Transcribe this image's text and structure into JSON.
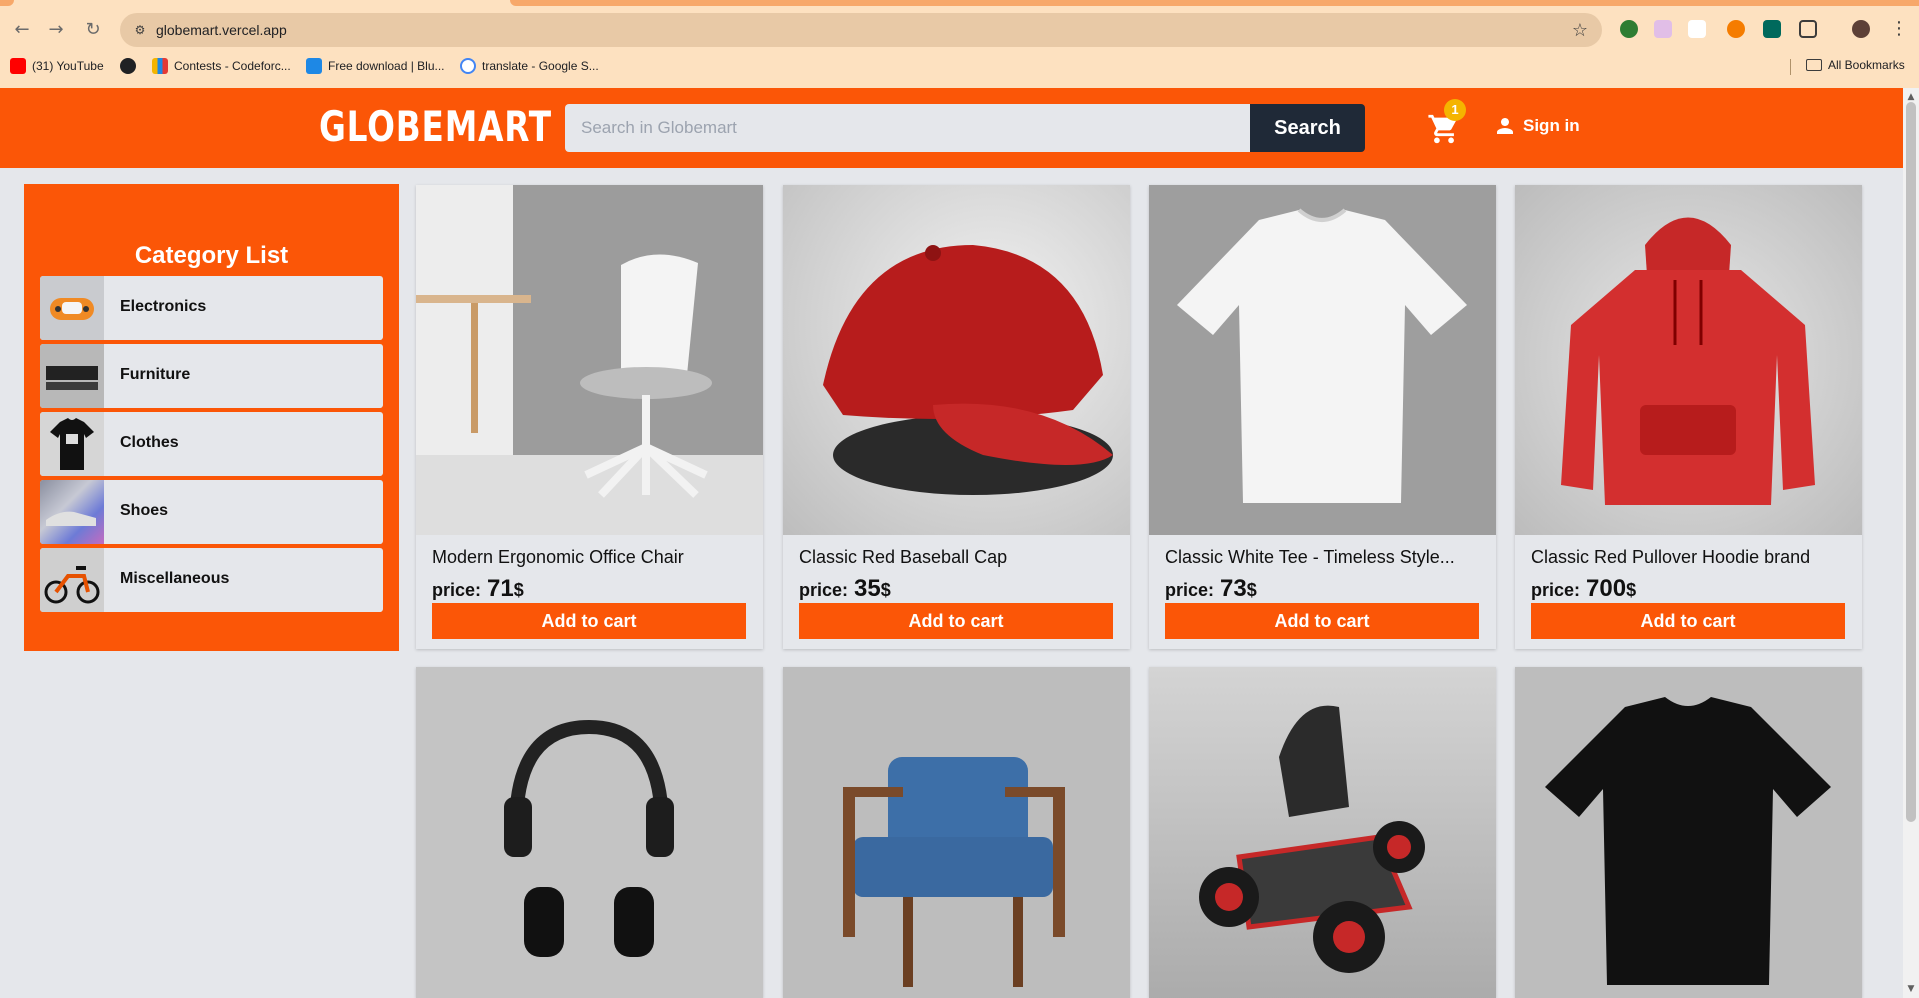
{
  "browser": {
    "url": "globemart.vercel.app",
    "bookmarks": [
      {
        "label": "(31) YouTube",
        "icon": "youtube-icon",
        "color": "#ff0000"
      },
      {
        "label": "",
        "icon": "globe-icon",
        "color": "#202124"
      },
      {
        "label": "Contests - Codeforc...",
        "icon": "codeforces-icon",
        "color": "#3b5998"
      },
      {
        "label": "Free download | Blu...",
        "icon": "bluestacks-icon",
        "color": "#1e88e5"
      },
      {
        "label": "translate - Google S...",
        "icon": "google-icon",
        "color": "#4285f4"
      }
    ],
    "all_bookmarks_label": "All Bookmarks"
  },
  "header": {
    "logo": "GLOBEMART",
    "search_placeholder": "Search in Globemart",
    "search_button": "Search",
    "cart_count": "1",
    "signin_label": "Sign in"
  },
  "sidebar": {
    "title": "Category List",
    "categories": [
      {
        "label": "Electronics"
      },
      {
        "label": "Furniture"
      },
      {
        "label": "Clothes"
      },
      {
        "label": "Shoes"
      },
      {
        "label": "Miscellaneous"
      }
    ]
  },
  "products": [
    {
      "name": "Modern Ergonomic Office Chair",
      "price_label": "price:",
      "price": "71",
      "currency": "$",
      "button": "Add to cart"
    },
    {
      "name": "Classic Red Baseball Cap",
      "price_label": "price:",
      "price": "35",
      "currency": "$",
      "button": "Add to cart"
    },
    {
      "name": "Classic White Tee - Timeless Style...",
      "price_label": "price:",
      "price": "73",
      "currency": "$",
      "button": "Add to cart"
    },
    {
      "name": "Classic Red Pullover Hoodie brand",
      "price_label": "price:",
      "price": "700",
      "currency": "$",
      "button": "Add to cart"
    },
    {
      "name": "",
      "price_label": "",
      "price": "",
      "currency": "",
      "button": ""
    },
    {
      "name": "",
      "price_label": "",
      "price": "",
      "currency": "",
      "button": ""
    },
    {
      "name": "",
      "price_label": "",
      "price": "",
      "currency": "",
      "button": ""
    },
    {
      "name": "",
      "price_label": "",
      "price": "",
      "currency": "",
      "button": ""
    }
  ],
  "colors": {
    "brand": "#fb5607",
    "dark": "#1f2937",
    "surface": "#e5e7eb",
    "badge": "#f5b400"
  }
}
